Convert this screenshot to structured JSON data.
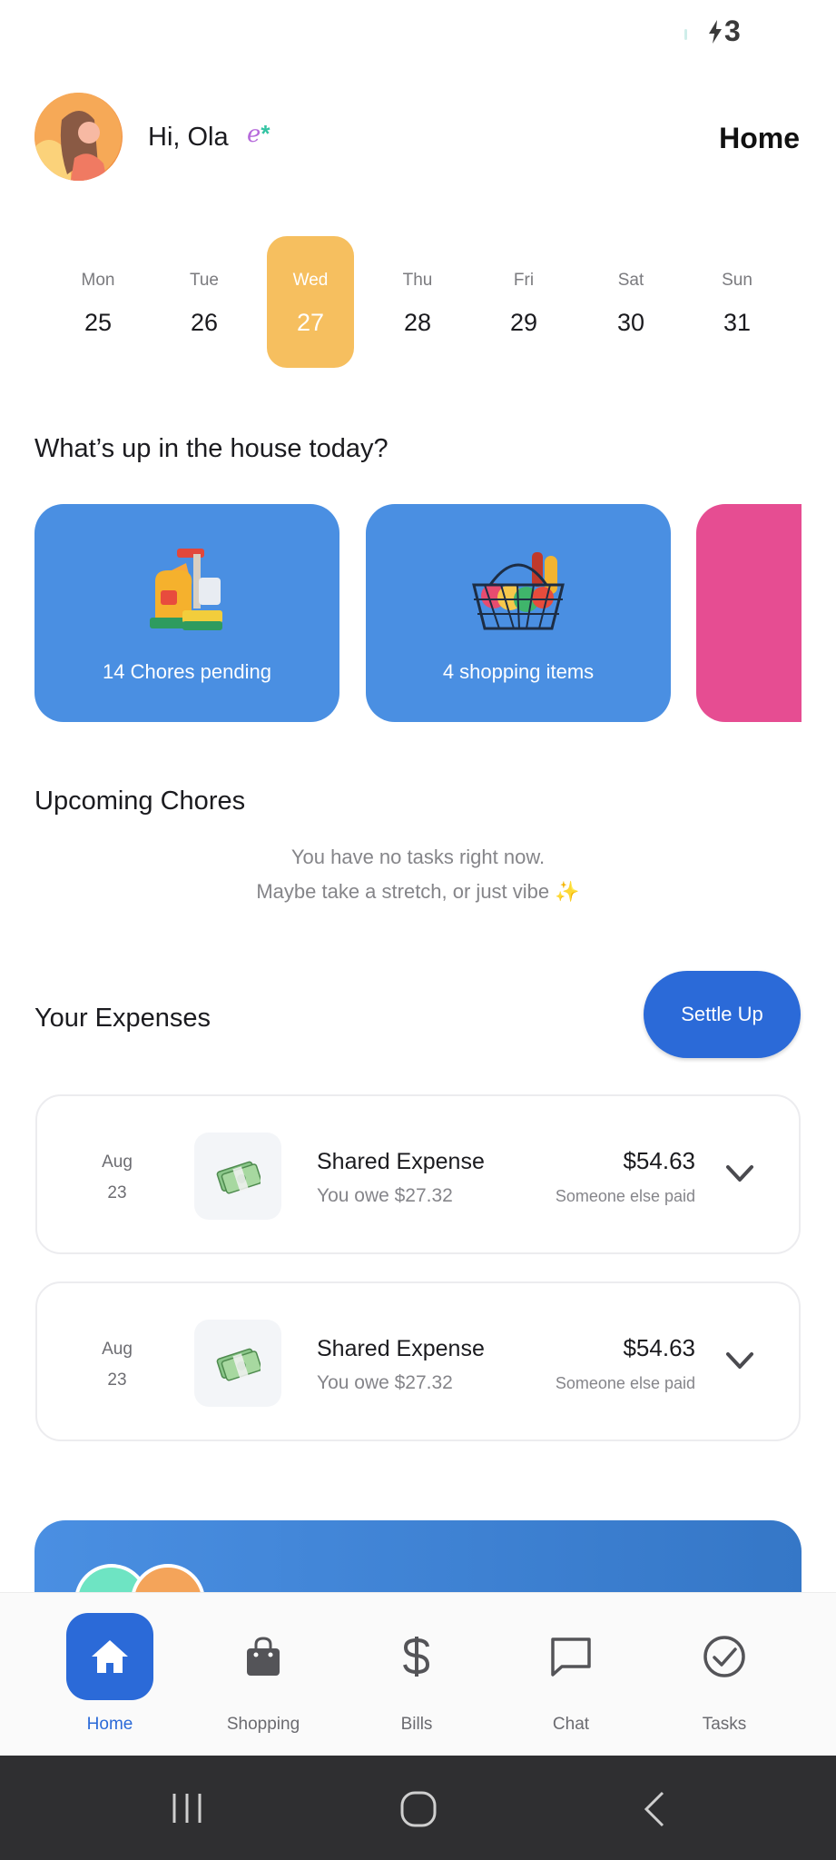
{
  "status": {
    "battery_text": "3"
  },
  "header": {
    "greeting": "Hi, Ola",
    "title": "Home"
  },
  "week": [
    {
      "name": "Mon",
      "date": "25",
      "active": false
    },
    {
      "name": "Tue",
      "date": "26",
      "active": false
    },
    {
      "name": "Wed",
      "date": "27",
      "active": true
    },
    {
      "name": "Thu",
      "date": "28",
      "active": false
    },
    {
      "name": "Fri",
      "date": "29",
      "active": false
    },
    {
      "name": "Sat",
      "date": "30",
      "active": false
    },
    {
      "name": "Sun",
      "date": "31",
      "active": false
    }
  ],
  "today": {
    "title": "What’s up in the house today?",
    "cards": [
      {
        "label": "14 Chores pending",
        "icon": "cleaning-supplies-icon",
        "color": "#4a8fe2"
      },
      {
        "label": "4 shopping items",
        "icon": "shopping-basket-icon",
        "color": "#4a8fe2"
      },
      {
        "label": "",
        "icon": "",
        "color": "#e64d92"
      }
    ]
  },
  "chores": {
    "title": "Upcoming Chores",
    "empty_line1": "You have no tasks right now.",
    "empty_line2": "Maybe take a stretch, or just vibe ✨"
  },
  "expenses": {
    "title": "Your Expenses",
    "settle_label": "Settle Up",
    "items": [
      {
        "month": "Aug",
        "day": "23",
        "icon": "money-icon",
        "name": "Shared Expense",
        "owe": "You owe $27.32",
        "amount": "$54.63",
        "payer": "Someone else paid"
      },
      {
        "month": "Aug",
        "day": "23",
        "icon": "money-icon",
        "name": "Shared Expense",
        "owe": "You owe $27.32",
        "amount": "$54.63",
        "payer": "Someone else paid"
      }
    ]
  },
  "nav": {
    "items": [
      {
        "label": "Home",
        "icon": "home-icon",
        "active": true
      },
      {
        "label": "Shopping",
        "icon": "shopping-bag-icon",
        "active": false
      },
      {
        "label": "Bills",
        "icon": "dollar-icon",
        "active": false
      },
      {
        "label": "Chat",
        "icon": "chat-icon",
        "active": false
      },
      {
        "label": "Tasks",
        "icon": "check-circle-icon",
        "active": false
      }
    ]
  },
  "colors": {
    "accent": "#2b6ad8",
    "card_blue": "#4a8fe2",
    "card_pink": "#e64d92",
    "day_active": "#f6bf5f"
  }
}
